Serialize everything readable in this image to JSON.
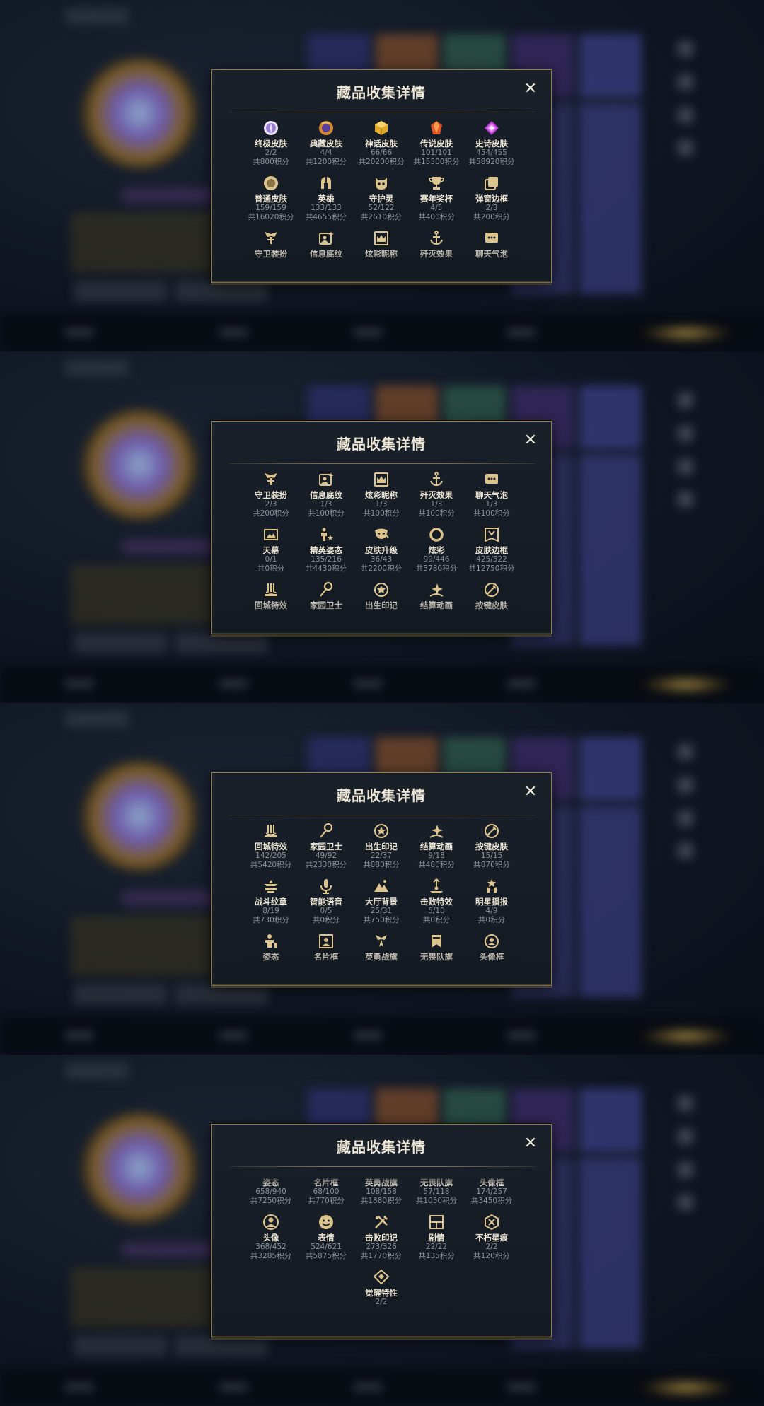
{
  "dialog_title": "藏品收集详情",
  "close_symbol": "✕",
  "colors": {
    "gold": "#d9c08b",
    "accent": "#8c7a4d",
    "text": "#e9e3d3",
    "muted": "#8d929a"
  },
  "screens": [
    {
      "rows": [
        [
          {
            "icon": "purple-gem-icon",
            "name": "终极皮肤",
            "count": "2/2",
            "points": "共800积分"
          },
          {
            "icon": "dragon-gem-icon",
            "name": "典藏皮肤",
            "count": "4/4",
            "points": "共1200积分"
          },
          {
            "icon": "gold-cube-icon",
            "name": "神话皮肤",
            "count": "66/66",
            "points": "共20200积分"
          },
          {
            "icon": "orange-gem-icon",
            "name": "传说皮肤",
            "count": "101/101",
            "points": "共15300积分"
          },
          {
            "icon": "magenta-gem-icon",
            "name": "史诗皮肤",
            "count": "454/455",
            "points": "共58920积分"
          }
        ],
        [
          {
            "icon": "circle-medal-icon",
            "name": "普通皮肤",
            "count": "159/159",
            "points": "共16020积分"
          },
          {
            "icon": "helmet-icon",
            "name": "英雄",
            "count": "133/133",
            "points": "共4655积分"
          },
          {
            "icon": "guardian-spirit-icon",
            "name": "守护灵",
            "count": "52/122",
            "points": "共2610积分"
          },
          {
            "icon": "trophy-icon",
            "name": "赛年奖杯",
            "count": "4/5",
            "points": "共400积分"
          },
          {
            "icon": "frame-stack-icon",
            "name": "弹窗边框",
            "count": "2/3",
            "points": "共200积分"
          }
        ],
        [
          {
            "icon": "wings-emblem-icon",
            "name": "守卫装扮",
            "count": "",
            "points": ""
          },
          {
            "icon": "profile-card-icon",
            "name": "信息底纹",
            "count": "",
            "points": ""
          },
          {
            "icon": "crown-banner-icon",
            "name": "炫彩昵称",
            "count": "",
            "points": ""
          },
          {
            "icon": "anchor-icon",
            "name": "歼灭效果",
            "count": "",
            "points": ""
          },
          {
            "icon": "chat-bubble-icon",
            "name": "聊天气泡",
            "count": "",
            "points": ""
          }
        ]
      ]
    },
    {
      "rows": [
        [
          {
            "icon": "wings-emblem-icon",
            "name": "守卫装扮",
            "count": "2/3",
            "points": "共200积分"
          },
          {
            "icon": "profile-card-icon",
            "name": "信息底纹",
            "count": "1/3",
            "points": "共100积分"
          },
          {
            "icon": "crown-banner-icon",
            "name": "炫彩昵称",
            "count": "1/3",
            "points": "共100积分"
          },
          {
            "icon": "anchor-icon",
            "name": "歼灭效果",
            "count": "1/3",
            "points": "共100积分"
          },
          {
            "icon": "chat-bubble-icon",
            "name": "聊天气泡",
            "count": "1/3",
            "points": "共100积分"
          }
        ],
        [
          {
            "icon": "sky-image-icon",
            "name": "天幕",
            "count": "0/1",
            "points": "共0积分"
          },
          {
            "icon": "elite-pose-icon",
            "name": "精英姿态",
            "count": "135/216",
            "points": "共4430积分"
          },
          {
            "icon": "mask-upgrade-icon",
            "name": "皮肤升级",
            "count": "36/43",
            "points": "共2200积分"
          },
          {
            "icon": "ring-icon",
            "name": "炫彩",
            "count": "99/446",
            "points": "共3780积分"
          },
          {
            "icon": "skin-frame-icon",
            "name": "皮肤边框",
            "count": "425/522",
            "points": "共12750积分"
          }
        ],
        [
          {
            "icon": "return-effect-icon",
            "name": "回城特效",
            "count": "",
            "points": ""
          },
          {
            "icon": "guardian-wand-icon",
            "name": "家园卫士",
            "count": "",
            "points": ""
          },
          {
            "icon": "birth-mark-icon",
            "name": "出生印记",
            "count": "",
            "points": ""
          },
          {
            "icon": "sparkle-anim-icon",
            "name": "结算动画",
            "count": "",
            "points": ""
          },
          {
            "icon": "key-skin-icon",
            "name": "按键皮肤",
            "count": "",
            "points": ""
          }
        ]
      ]
    },
    {
      "rows": [
        [
          {
            "icon": "return-effect-icon",
            "name": "回城特效",
            "count": "142/205",
            "points": "共5420积分"
          },
          {
            "icon": "guardian-wand-icon",
            "name": "家园卫士",
            "count": "49/92",
            "points": "共2330积分"
          },
          {
            "icon": "birth-mark-icon",
            "name": "出生印记",
            "count": "22/37",
            "points": "共880积分"
          },
          {
            "icon": "sparkle-anim-icon",
            "name": "结算动画",
            "count": "9/18",
            "points": "共480积分"
          },
          {
            "icon": "key-skin-icon",
            "name": "按键皮肤",
            "count": "15/15",
            "points": "共870积分"
          }
        ],
        [
          {
            "icon": "battle-emblem-icon",
            "name": "战斗纹章",
            "count": "8/19",
            "points": "共730积分"
          },
          {
            "icon": "microphone-icon",
            "name": "智能语音",
            "count": "0/5",
            "points": "共0积分"
          },
          {
            "icon": "mountain-icon",
            "name": "大厅背景",
            "count": "25/31",
            "points": "共750积分"
          },
          {
            "icon": "defeat-effect-icon",
            "name": "击败特效",
            "count": "5/10",
            "points": "共0积分"
          },
          {
            "icon": "star-broadcast-icon",
            "name": "明星播报",
            "count": "4/9",
            "points": "共0积分"
          }
        ],
        [
          {
            "icon": "pose-icon",
            "name": "姿态",
            "count": "",
            "points": ""
          },
          {
            "icon": "name-card-icon",
            "name": "名片框",
            "count": "",
            "points": ""
          },
          {
            "icon": "hero-banner-icon",
            "name": "英勇战旗",
            "count": "",
            "points": ""
          },
          {
            "icon": "team-flag-icon",
            "name": "无畏队旗",
            "count": "",
            "points": ""
          },
          {
            "icon": "avatar-frame-icon",
            "name": "头像框",
            "count": "",
            "points": ""
          }
        ]
      ]
    },
    {
      "rows": [
        [
          {
            "icon": "pose-icon",
            "name": "姿态",
            "count": "658/940",
            "points": "共7250积分"
          },
          {
            "icon": "name-card-icon",
            "name": "名片框",
            "count": "68/100",
            "points": "共770积分"
          },
          {
            "icon": "hero-banner-icon",
            "name": "英勇战旗",
            "count": "108/158",
            "points": "共1880积分"
          },
          {
            "icon": "team-flag-icon",
            "name": "无畏队旗",
            "count": "57/118",
            "points": "共1050积分"
          },
          {
            "icon": "avatar-frame-icon",
            "name": "头像框",
            "count": "174/257",
            "points": "共3450积分"
          }
        ],
        [
          {
            "icon": "avatar-icon",
            "name": "头像",
            "count": "368/452",
            "points": "共3285积分"
          },
          {
            "icon": "emoji-icon",
            "name": "表情",
            "count": "524/621",
            "points": "共5875积分"
          },
          {
            "icon": "defeat-mark-icon",
            "name": "击败印记",
            "count": "273/326",
            "points": "共1770积分"
          },
          {
            "icon": "story-icon",
            "name": "剧情",
            "count": "22/22",
            "points": "共135积分"
          },
          {
            "icon": "immortal-mark-icon",
            "name": "不朽星痕",
            "count": "2/2",
            "points": "共120积分"
          }
        ],
        [
          {
            "icon": "awaken-icon",
            "name": "觉醒特性",
            "count": "2/2",
            "points": ""
          }
        ]
      ]
    }
  ]
}
